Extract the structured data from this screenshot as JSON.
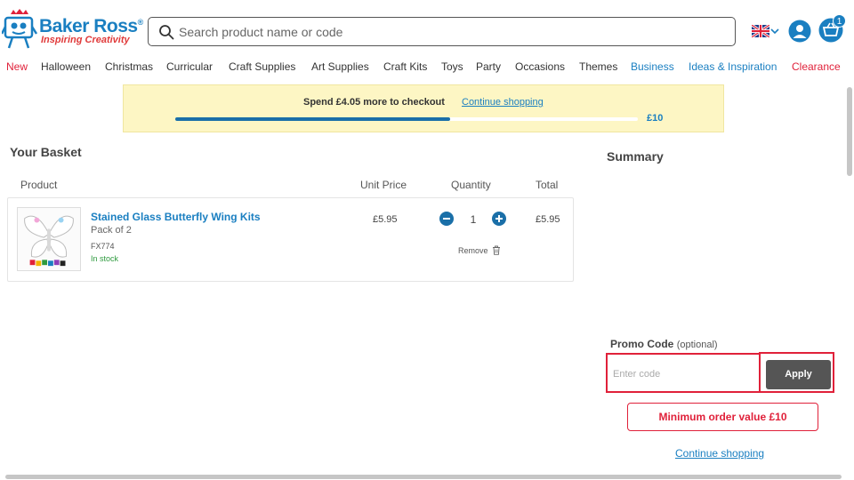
{
  "brand": {
    "name": "Baker Ross",
    "registered": "®",
    "tagline": "Inspiring Creativity",
    "colors": {
      "primary": "#1a7fc1",
      "accent_red": "#e0213a",
      "stock_green": "#2e9a3e",
      "banner_bg": "#fdf6c4"
    }
  },
  "search": {
    "placeholder": "Search product name or code",
    "value": ""
  },
  "header": {
    "country_flag": "uk-flag-icon",
    "cart_count": "1"
  },
  "nav": {
    "items": [
      {
        "label": "New",
        "style": "red"
      },
      {
        "label": "Halloween",
        "style": "default"
      },
      {
        "label": "Christmas",
        "style": "default"
      },
      {
        "label": "Curricular",
        "style": "default"
      },
      {
        "label": "Craft Supplies",
        "style": "default"
      },
      {
        "label": "Art Supplies",
        "style": "default"
      },
      {
        "label": "Craft Kits",
        "style": "default"
      },
      {
        "label": "Toys",
        "style": "default"
      },
      {
        "label": "Party",
        "style": "default"
      },
      {
        "label": "Occasions",
        "style": "default"
      },
      {
        "label": "Themes",
        "style": "default"
      },
      {
        "label": "Business",
        "style": "blue"
      },
      {
        "label": "Ideas & Inspiration",
        "style": "blue"
      },
      {
        "label": "Clearance",
        "style": "red"
      }
    ]
  },
  "banner": {
    "message": "Spend £4.05 more to checkout",
    "link": "Continue shopping",
    "progress_fraction": 0.595,
    "target_label": "£10"
  },
  "basket": {
    "title": "Your Basket",
    "columns": {
      "product": "Product",
      "unit_price": "Unit Price",
      "quantity": "Quantity",
      "total": "Total"
    },
    "items": [
      {
        "name": "Stained Glass Butterfly Wing Kits",
        "pack": "Pack of 2",
        "code": "FX774",
        "stock": "In stock",
        "unit_price": "£5.95",
        "quantity": "1",
        "total": "£5.95",
        "remove_label": "Remove"
      }
    ]
  },
  "summary": {
    "title": "Summary",
    "promo_label": "Promo Code",
    "promo_optional": "(optional)",
    "promo_placeholder": "Enter code",
    "apply_label": "Apply",
    "min_order": "Minimum order value £10",
    "continue": "Continue shopping"
  }
}
